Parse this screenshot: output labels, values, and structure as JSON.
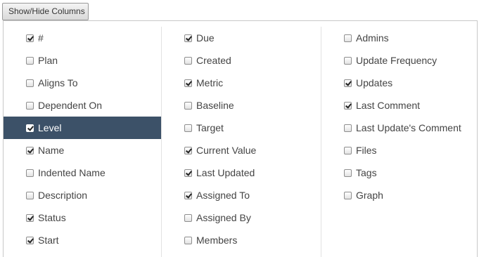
{
  "toolbar": {
    "toggle_label": "Show/Hide Columns"
  },
  "columns": {
    "col1": [
      {
        "label": "#",
        "checked": true,
        "selected": false
      },
      {
        "label": "Plan",
        "checked": false,
        "selected": false
      },
      {
        "label": "Aligns To",
        "checked": false,
        "selected": false
      },
      {
        "label": "Dependent On",
        "checked": false,
        "selected": false
      },
      {
        "label": "Level",
        "checked": true,
        "selected": true
      },
      {
        "label": "Name",
        "checked": true,
        "selected": false
      },
      {
        "label": "Indented Name",
        "checked": false,
        "selected": false
      },
      {
        "label": "Description",
        "checked": false,
        "selected": false
      },
      {
        "label": "Status",
        "checked": true,
        "selected": false
      },
      {
        "label": "Start",
        "checked": true,
        "selected": false
      }
    ],
    "col2": [
      {
        "label": "Due",
        "checked": true,
        "selected": false
      },
      {
        "label": "Created",
        "checked": false,
        "selected": false
      },
      {
        "label": "Metric",
        "checked": true,
        "selected": false
      },
      {
        "label": "Baseline",
        "checked": false,
        "selected": false
      },
      {
        "label": "Target",
        "checked": false,
        "selected": false
      },
      {
        "label": "Current Value",
        "checked": true,
        "selected": false
      },
      {
        "label": "Last Updated",
        "checked": true,
        "selected": false
      },
      {
        "label": "Assigned To",
        "checked": true,
        "selected": false
      },
      {
        "label": "Assigned By",
        "checked": false,
        "selected": false
      },
      {
        "label": "Members",
        "checked": false,
        "selected": false
      }
    ],
    "col3": [
      {
        "label": "Admins",
        "checked": false,
        "selected": false
      },
      {
        "label": "Update Frequency",
        "checked": false,
        "selected": false
      },
      {
        "label": "Updates",
        "checked": true,
        "selected": false
      },
      {
        "label": "Last Comment",
        "checked": true,
        "selected": false
      },
      {
        "label": "Last Update's Comment",
        "checked": false,
        "selected": false
      },
      {
        "label": "Files",
        "checked": false,
        "selected": false
      },
      {
        "label": "Tags",
        "checked": false,
        "selected": false
      },
      {
        "label": "Graph",
        "checked": false,
        "selected": false
      }
    ]
  },
  "colors": {
    "selected_row": "#3c5168"
  }
}
